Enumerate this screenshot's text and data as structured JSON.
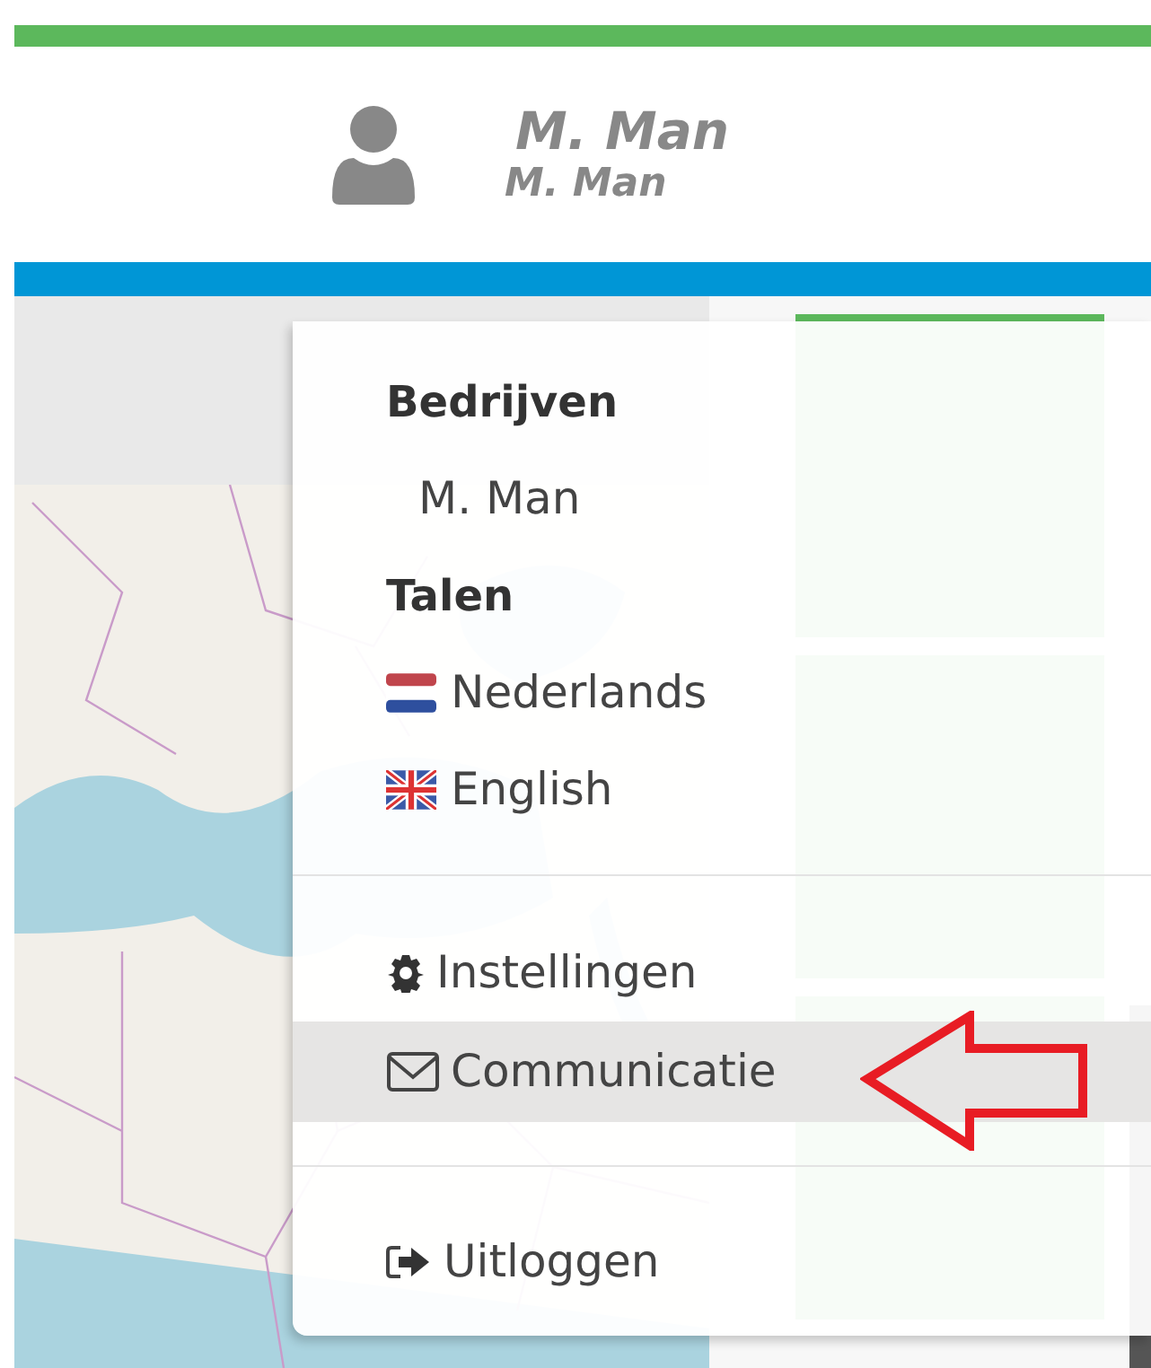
{
  "header": {
    "user_name": "M. Man",
    "company_name": "M. Man"
  },
  "menu": {
    "sections": [
      {
        "heading": "Bedrijven",
        "items": [
          {
            "label": "M. Man"
          }
        ]
      },
      {
        "heading": "Talen",
        "items": [
          {
            "label": "Nederlands"
          },
          {
            "label": "English"
          }
        ]
      }
    ],
    "actions": [
      {
        "label": "Instellingen",
        "selected": false
      },
      {
        "label": "Communicatie",
        "selected": true
      }
    ],
    "footer": [
      {
        "label": "Uitloggen"
      }
    ]
  }
}
